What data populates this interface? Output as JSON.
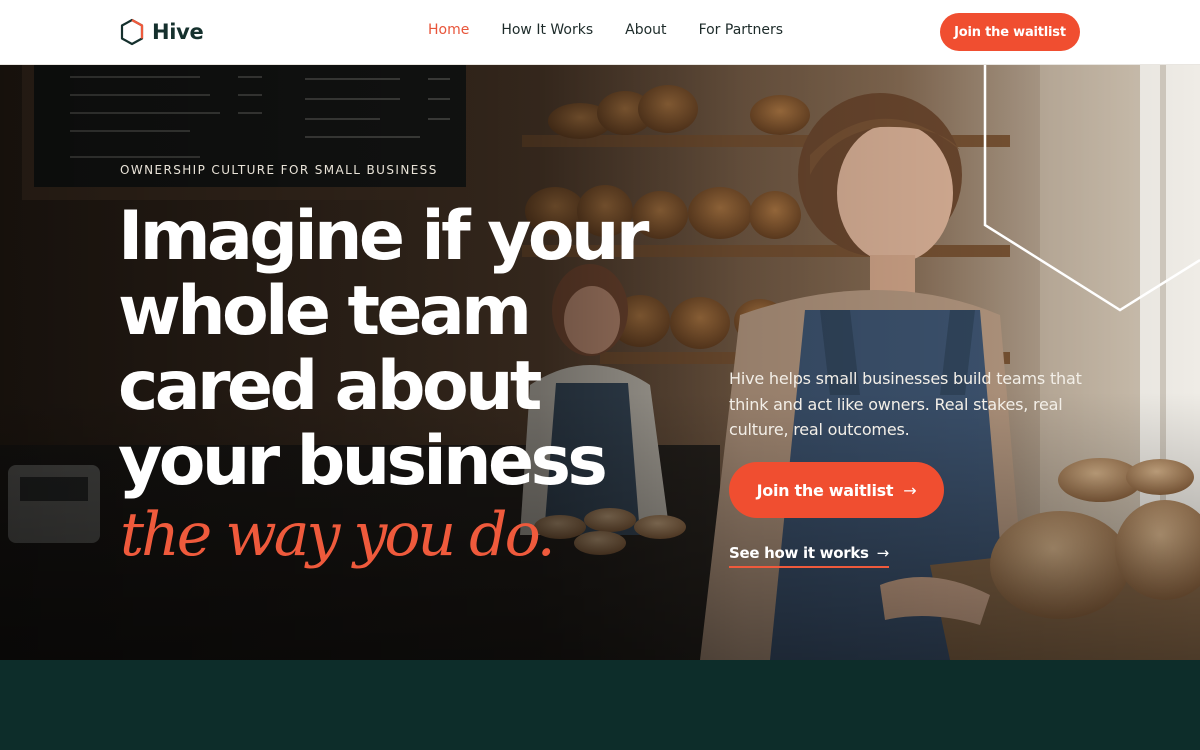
{
  "brand": {
    "name": "Hive",
    "logo_icon": "hexagon-icon"
  },
  "nav": {
    "items": [
      {
        "label": "Home",
        "active": true
      },
      {
        "label": "How It Works",
        "active": false
      },
      {
        "label": "About",
        "active": false
      },
      {
        "label": "For Partners",
        "active": false
      }
    ],
    "cta_label": "Join the waitlist"
  },
  "hero": {
    "eyebrow": "Ownership culture for small business",
    "headline_lines": [
      "Imagine if your",
      "whole team",
      "cared about",
      "your business"
    ],
    "headline_accent": "the way you do.",
    "intro": "Hive helps small businesses build teams that think and act like owners. Real stakes, real culture, real outcomes.",
    "primary_cta": {
      "label": "Join the waitlist",
      "arrow": "→",
      "icon": "arrow-right-icon"
    },
    "secondary_link": {
      "label": "See how it works",
      "arrow": "→",
      "icon": "arrow-right-icon"
    }
  },
  "colors": {
    "accent": "#f04e30",
    "brand_dark": "#15302d",
    "section_dark": "#0d2d2a"
  }
}
